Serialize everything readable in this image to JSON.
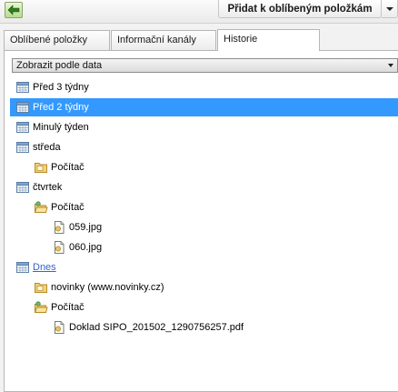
{
  "toolbar": {
    "add_favorite_label": "Přidat k oblíbeným položkám"
  },
  "tabs": [
    {
      "label": "Oblíbené položky"
    },
    {
      "label": "Informační kanály"
    },
    {
      "label": "Historie"
    }
  ],
  "view_select": {
    "value": "Zobrazit podle data"
  },
  "history": [
    {
      "label": "Před 3 týdny",
      "icon": "calendar-icon",
      "level": 0
    },
    {
      "label": "Před 2 týdny",
      "icon": "calendar-icon",
      "level": 0,
      "selected": true
    },
    {
      "label": "Minulý týden",
      "icon": "calendar-icon",
      "level": 0
    },
    {
      "label": "středa",
      "icon": "calendar-icon",
      "level": 0
    },
    {
      "label": "Počítač",
      "icon": "computer-folder-icon",
      "level": 1
    },
    {
      "label": "čtvrtek",
      "icon": "calendar-icon",
      "level": 0
    },
    {
      "label": "Počítač",
      "icon": "computer-folder-open-icon",
      "level": 1
    },
    {
      "label": "059.jpg",
      "icon": "file-icon",
      "level": 2
    },
    {
      "label": "060.jpg",
      "icon": "file-icon",
      "level": 2
    },
    {
      "label": "Dnes",
      "icon": "calendar-icon",
      "level": 0,
      "link": true
    },
    {
      "label": "novinky (www.novinky.cz)",
      "icon": "site-folder-icon",
      "level": 1
    },
    {
      "label": "Počítač",
      "icon": "computer-folder-open-icon",
      "level": 1
    },
    {
      "label": "Doklad SIPO_201502_1290756257.pdf",
      "icon": "file-icon",
      "level": 2
    }
  ],
  "colors": {
    "selection": "#3399ff",
    "link": "#3366cc"
  }
}
